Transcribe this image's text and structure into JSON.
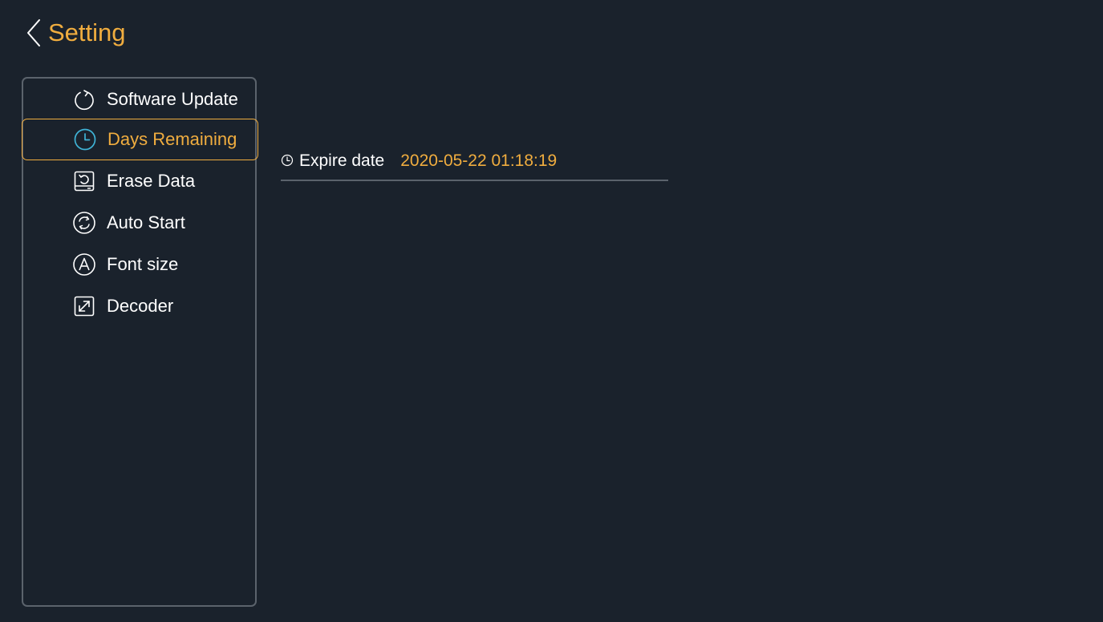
{
  "header": {
    "title": "Setting",
    "back_icon": "chevron-left-icon"
  },
  "colors": {
    "background": "#1a222c",
    "accent": "#f0ad3f",
    "text": "#ffffff",
    "border": "#5b636c",
    "active_icon": "#3fb3d6"
  },
  "sidebar": {
    "items": [
      {
        "label": "Software Update",
        "icon": "refresh-icon",
        "active": false
      },
      {
        "label": "Days Remaining",
        "icon": "clock-icon",
        "active": true
      },
      {
        "label": "Erase Data",
        "icon": "erase-icon",
        "active": false
      },
      {
        "label": "Auto Start",
        "icon": "sync-icon",
        "active": false
      },
      {
        "label": "Font size",
        "icon": "font-icon",
        "active": false
      },
      {
        "label": "Decoder",
        "icon": "expand-icon",
        "active": false
      }
    ]
  },
  "main": {
    "expire": {
      "label": "Expire date",
      "value": "2020-05-22 01:18:19",
      "icon": "clock-icon"
    }
  }
}
